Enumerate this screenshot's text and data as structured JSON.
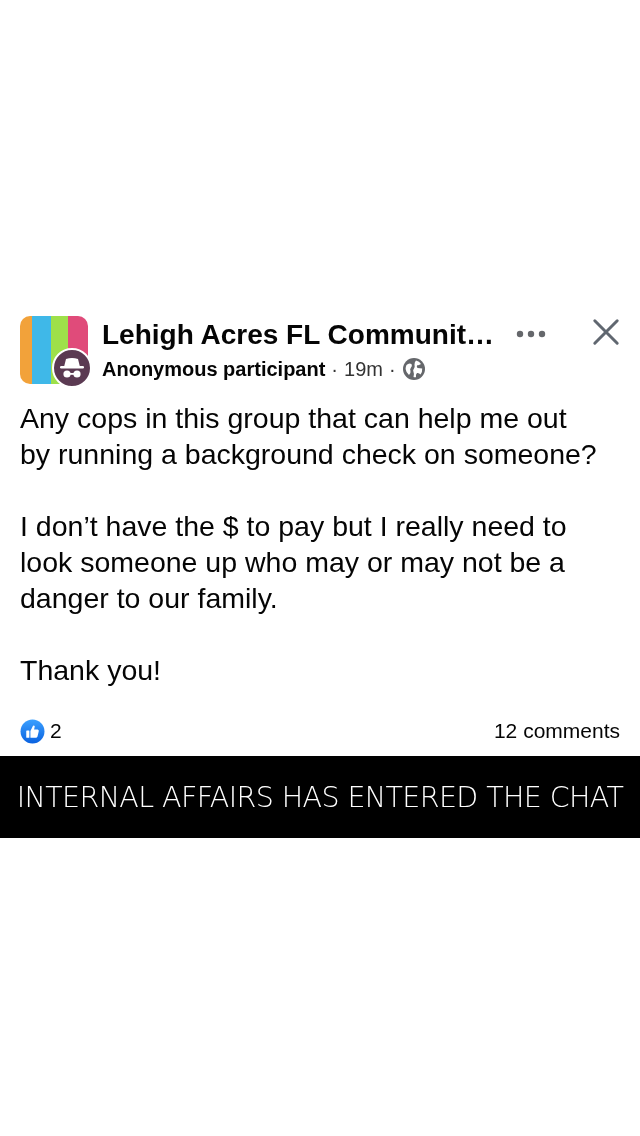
{
  "post": {
    "group_name": "Lehigh Acres FL Communit…",
    "author": "Anonymous participant",
    "separator_1": "·",
    "time": "19m",
    "separator_2": "·",
    "paragraphs": [
      "Any cops in this group that can help me out by running a background check on someone?",
      "I don’t have the $ to pay but I really need to look someone up who may or may not be a danger to our family.",
      "Thank you!"
    ],
    "reactions_count": "2",
    "comments": "12 comments"
  },
  "caption": "INTERNAL AFFAIRS HAS ENTERED THE CHAT"
}
